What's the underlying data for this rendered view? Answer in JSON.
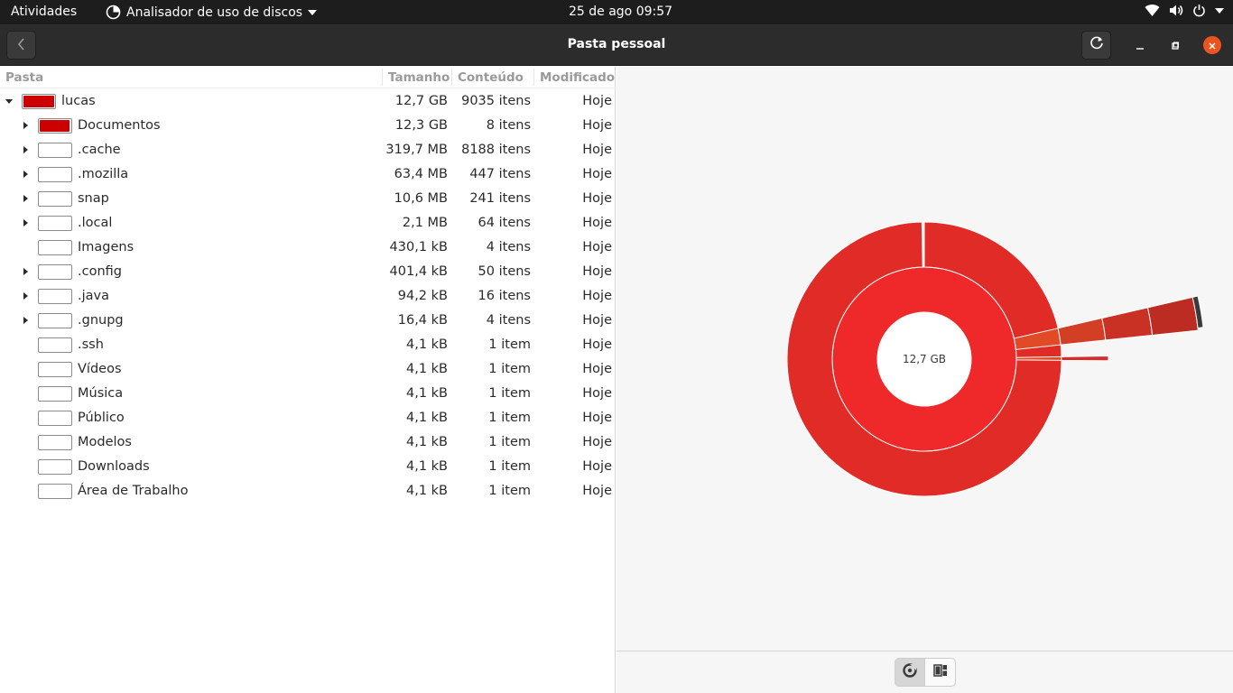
{
  "topbar": {
    "activities": "Atividades",
    "app_name": "Analisador de uso de discos",
    "clock": "25 de ago  09:57",
    "icons": [
      "disk-usage-icon",
      "dropdown-arrow-icon",
      "wifi-icon",
      "volume-icon",
      "power-icon",
      "system-menu-arrow-icon"
    ]
  },
  "header": {
    "title": "Pasta pessoal",
    "icons": [
      "back-icon",
      "refresh-icon",
      "minimize-icon",
      "maximize-icon",
      "close-icon"
    ],
    "close_color": "#e95420"
  },
  "tree": {
    "columns": {
      "folder": "Pasta",
      "size": "Tamanho",
      "contents": "Conteúdo",
      "modified": "Modificado"
    },
    "rows": [
      {
        "name": "lucas",
        "size": "12,7 GB",
        "contents": "9035 itens",
        "modified": "Hoje",
        "level": 0,
        "expander": "down",
        "usage": 1.0
      },
      {
        "name": "Documentos",
        "size": "12,3 GB",
        "contents": "8 itens",
        "modified": "Hoje",
        "level": 1,
        "expander": "right",
        "usage": 0.97
      },
      {
        "name": ".cache",
        "size": "319,7 MB",
        "contents": "8188 itens",
        "modified": "Hoje",
        "level": 1,
        "expander": "right",
        "usage": 0.025
      },
      {
        "name": ".mozilla",
        "size": "63,4 MB",
        "contents": "447 itens",
        "modified": "Hoje",
        "level": 1,
        "expander": "right",
        "usage": 0.005
      },
      {
        "name": "snap",
        "size": "10,6 MB",
        "contents": "241 itens",
        "modified": "Hoje",
        "level": 1,
        "expander": "right",
        "usage": 0.001
      },
      {
        "name": ".local",
        "size": "2,1 MB",
        "contents": "64 itens",
        "modified": "Hoje",
        "level": 1,
        "expander": "right",
        "usage": 0
      },
      {
        "name": "Imagens",
        "size": "430,1 kB",
        "contents": "4 itens",
        "modified": "Hoje",
        "level": 1,
        "expander": "none",
        "usage": 0
      },
      {
        "name": ".config",
        "size": "401,4 kB",
        "contents": "50 itens",
        "modified": "Hoje",
        "level": 1,
        "expander": "right",
        "usage": 0
      },
      {
        "name": ".java",
        "size": "94,2 kB",
        "contents": "16 itens",
        "modified": "Hoje",
        "level": 1,
        "expander": "right",
        "usage": 0
      },
      {
        "name": ".gnupg",
        "size": "16,4 kB",
        "contents": "4 itens",
        "modified": "Hoje",
        "level": 1,
        "expander": "right",
        "usage": 0
      },
      {
        "name": ".ssh",
        "size": "4,1 kB",
        "contents": "1 item",
        "modified": "Hoje",
        "level": 1,
        "expander": "none",
        "usage": 0
      },
      {
        "name": "Vídeos",
        "size": "4,1 kB",
        "contents": "1 item",
        "modified": "Hoje",
        "level": 1,
        "expander": "none",
        "usage": 0
      },
      {
        "name": "Música",
        "size": "4,1 kB",
        "contents": "1 item",
        "modified": "Hoje",
        "level": 1,
        "expander": "none",
        "usage": 0
      },
      {
        "name": "Público",
        "size": "4,1 kB",
        "contents": "1 item",
        "modified": "Hoje",
        "level": 1,
        "expander": "none",
        "usage": 0
      },
      {
        "name": "Modelos",
        "size": "4,1 kB",
        "contents": "1 item",
        "modified": "Hoje",
        "level": 1,
        "expander": "none",
        "usage": 0
      },
      {
        "name": "Downloads",
        "size": "4,1 kB",
        "contents": "1 item",
        "modified": "Hoje",
        "level": 1,
        "expander": "none",
        "usage": 0
      },
      {
        "name": "Área de Trabalho",
        "size": "4,1 kB",
        "contents": "1 item",
        "modified": "Hoje",
        "level": 1,
        "expander": "none",
        "usage": 0
      }
    ],
    "usage_color": "#cc0000"
  },
  "chart": {
    "center_label": "12,7 GB",
    "type": "ring-chart",
    "colors": {
      "inner": "#ef2929",
      "outer": "#e02b27",
      "depth3": "#e04a27",
      "depth4": "#d23f25",
      "depth5": "#c93125",
      "depth6": "#bd2c22"
    }
  },
  "footer": {
    "buttons": [
      {
        "icon": "ring-chart-icon",
        "active": true
      },
      {
        "icon": "treemap-icon",
        "active": false
      }
    ]
  }
}
